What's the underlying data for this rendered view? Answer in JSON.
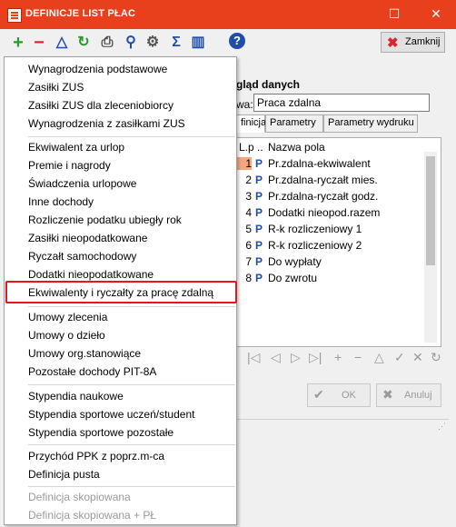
{
  "window": {
    "title": "DEFINICJE LIST PŁAC"
  },
  "toolbar": {
    "icons": [
      "add-icon",
      "remove-icon",
      "move-up-icon",
      "refresh-icon",
      "print-icon",
      "search-icon",
      "settings-icon",
      "sum-icon",
      "columns-icon",
      "help-icon"
    ],
    "close_label": "Zamknij"
  },
  "panel": {
    "group_title": "gląd danych",
    "name_label": "wa:",
    "name_value": "Praca zdalna",
    "tabs": [
      "finicja",
      "Parametry",
      "Parametry wydruku"
    ],
    "grid_headers": {
      "lp": "L.p",
      "dots": "..",
      "name": "Nazwa pola"
    },
    "rows": [
      {
        "lp": "1",
        "type": "P",
        "name": "Pr.zdalna-ekwiwalent"
      },
      {
        "lp": "2",
        "type": "P",
        "name": "Pr.zdalna-ryczałt mies."
      },
      {
        "lp": "3",
        "type": "P",
        "name": "Pr.zdalna-ryczałt godz."
      },
      {
        "lp": "4",
        "type": "P",
        "name": "Dodatki nieopod.razem"
      },
      {
        "lp": "5",
        "type": "P",
        "name": "R-k rozliczeniowy 1"
      },
      {
        "lp": "6",
        "type": "P",
        "name": "R-k rozliczeniowy 2"
      },
      {
        "lp": "7",
        "type": "P",
        "name": "Do wypłaty"
      },
      {
        "lp": "8",
        "type": "P",
        "name": "Do zwrotu"
      }
    ],
    "ok_label": "OK",
    "cancel_label": "Anuluj"
  },
  "menu": {
    "groups": [
      [
        "Wynagrodzenia podstawowe",
        "Zasiłki ZUS",
        "Zasiłki ZUS dla zleceniobiorcy",
        "Wynagrodzenia z zasiłkami ZUS"
      ],
      [
        "Ekwiwalent za urlop",
        "Premie i nagrody",
        "Świadczenia urlopowe",
        "Inne dochody",
        "Rozliczenie podatku ubiegły rok",
        "Zasiłki nieopodatkowane",
        "Ryczałt samochodowy",
        "Dodatki nieopodatkowane",
        "Ekwiwalenty i ryczałty za pracę zdalną"
      ],
      [
        "Umowy zlecenia",
        "Umowy o dzieło",
        "Umowy org.stanowiące",
        "Pozostałe dochody PIT-8A"
      ],
      [
        "Stypendia naukowe",
        "Stypendia sportowe uczeń/student",
        "Stypendia sportowe pozostałe"
      ],
      [
        "Przychód PPK z poprz.m-ca",
        "Definicja pusta"
      ],
      [
        "Definicja skopiowana",
        "Definicja skopiowana + PŁ"
      ]
    ],
    "highlighted": "Ekwiwalenty i ryczałty za pracę zdalną"
  },
  "colors": {
    "titlebar": "#e8401c",
    "highlight_border": "#e8161c",
    "selected_cell": "#f5a880"
  }
}
